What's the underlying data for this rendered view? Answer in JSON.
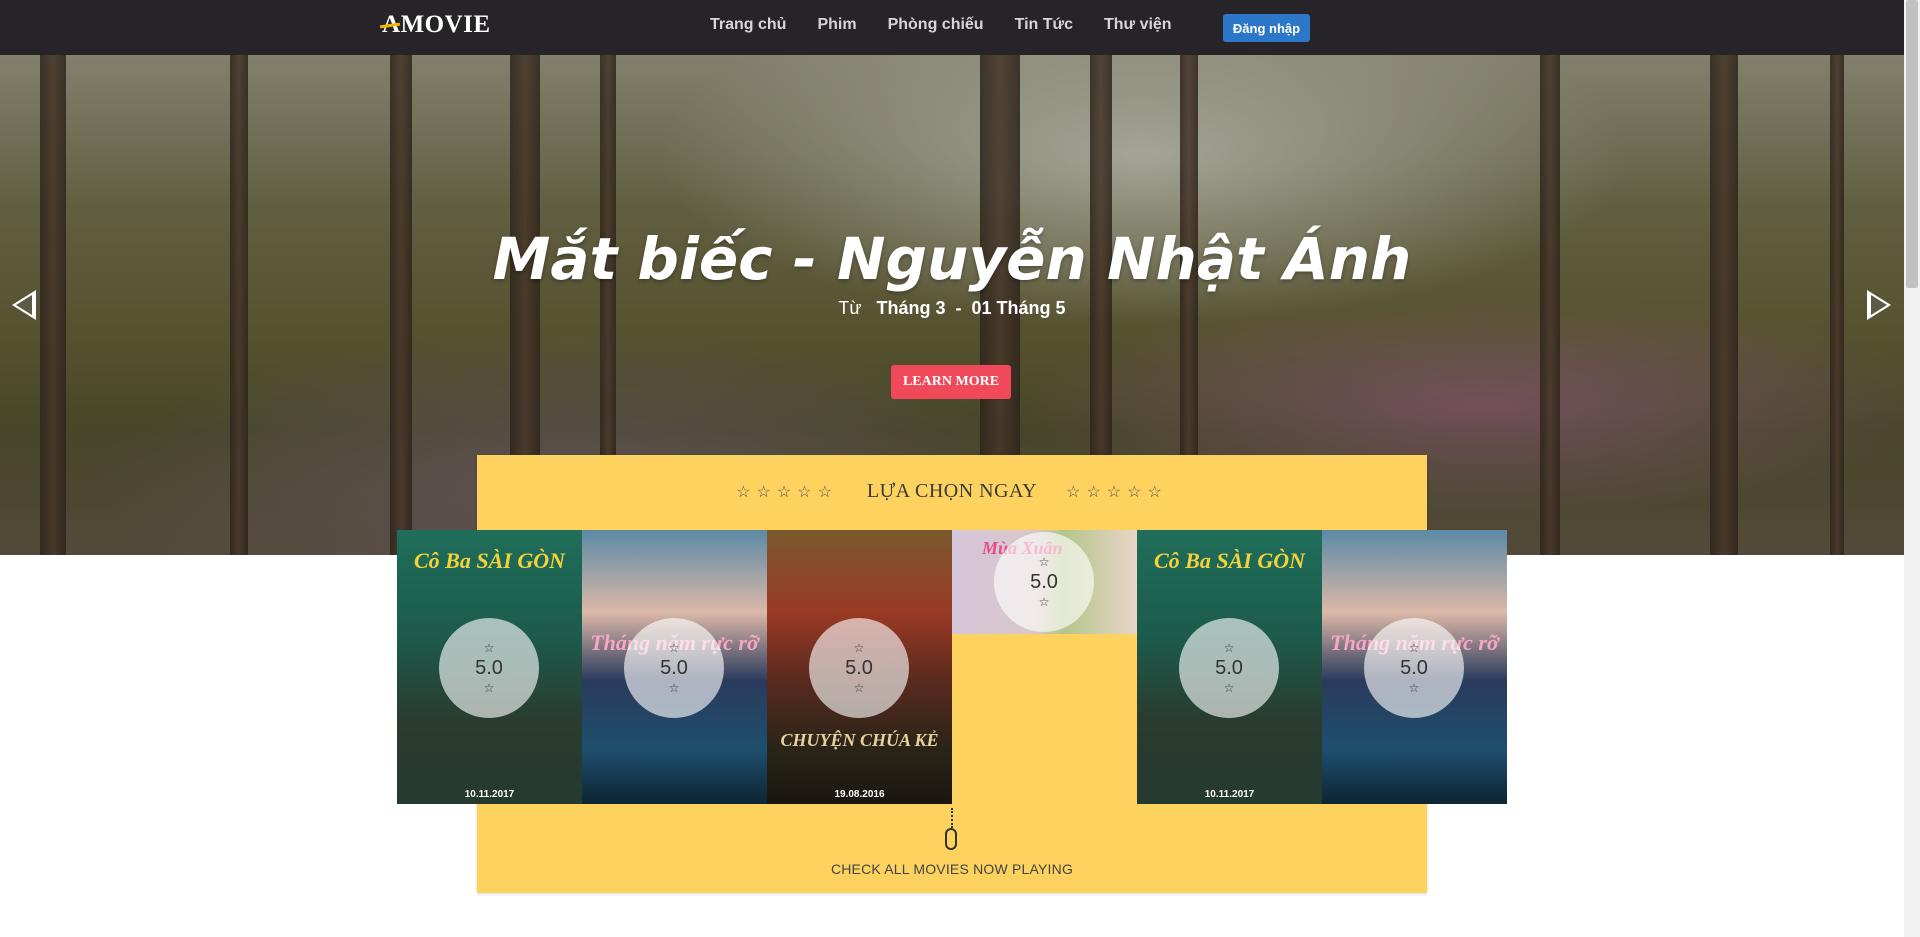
{
  "header": {
    "logo": "A-MOVIE",
    "logo_a": "A",
    "logo_rest": "MOVIE",
    "nav": [
      "Trang chủ",
      "Phim",
      "Phòng chiếu",
      "Tin Tức",
      "Thư viện"
    ],
    "login_label": "Đăng nhập",
    "login_color": "#2d77c9"
  },
  "hero": {
    "title": "Mắt biếc - Nguyễn Nhật Ánh",
    "date_prefix": "Từ",
    "date_start": "Tháng 3",
    "date_sep": "-",
    "date_end": "01 Tháng 5",
    "learn_more": "LEARN MORE",
    "learn_more_color": "#f0495a",
    "prev_icon": "arrow-left-icon",
    "next_icon": "arrow-right-icon"
  },
  "pick": {
    "stars_left": "☆☆☆☆☆",
    "label": "LỰA CHỌN NGAY",
    "stars_right": "☆☆☆☆☆",
    "bg_color": "#fdd25e"
  },
  "movies": [
    {
      "title": "Cô Ba SÀI GÒN",
      "date": "10.11.2017",
      "rating": "5.0",
      "star_top": "☆",
      "star_bottom": "☆"
    },
    {
      "title": "Tháng năm rực rỡ",
      "date": "",
      "rating": "5.0",
      "star_top": "☆",
      "star_bottom": "☆"
    },
    {
      "title": "CHUYỆN CHÚA KẺ",
      "date": "19.08.2016",
      "rating": "5.0",
      "star_top": "☆",
      "star_bottom": "☆"
    },
    {
      "title": "Mùa Xuân",
      "date": "",
      "rating": "5.0",
      "star_top": "☆",
      "star_bottom": "☆"
    },
    {
      "title": "Cô Ba SÀI GÒN",
      "date": "10.11.2017",
      "rating": "5.0",
      "star_top": "☆",
      "star_bottom": "☆"
    },
    {
      "title": "Tháng năm rực rỡ",
      "date": "",
      "rating": "5.0",
      "star_top": "☆",
      "star_bottom": "☆"
    }
  ],
  "footer": {
    "check_all": "CHECK ALL MOVIES NOW PLAYING",
    "scroll_icon": "mouse-scroll-icon"
  }
}
